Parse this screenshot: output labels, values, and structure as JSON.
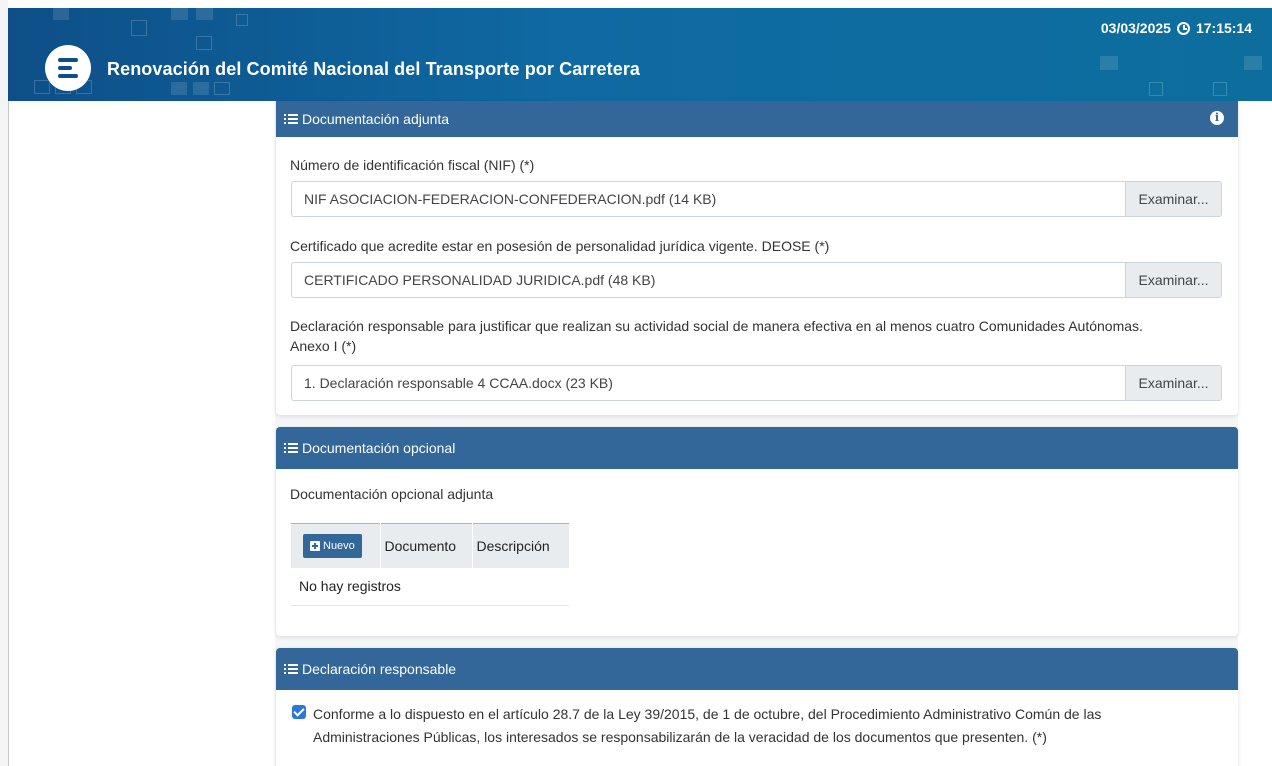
{
  "header": {
    "title": "Renovación del Comité Nacional del Transporte por Carretera",
    "date": "03/03/2025",
    "time": "17:15:14",
    "logo_icon": "app-logo",
    "clock_icon": "clock-icon",
    "gradient_start": "#0e4f88",
    "gradient_end": "#0d6e9e"
  },
  "colors": {
    "card_header": "#336699",
    "checkbox": "#2d78d2"
  },
  "attached": {
    "title": "Documentación adjunta",
    "fields": [
      {
        "label": "Número de identificación fiscal (NIF) (*)",
        "value": "NIF ASOCIACION-FEDERACION-CONFEDERACION.pdf (14 KB)",
        "button": "Examinar..."
      },
      {
        "label": "Certificado que acredite estar en posesión de personalidad jurídica vigente. DEOSE (*)",
        "value": "CERTIFICADO PERSONALIDAD JURIDICA.pdf (48 KB)",
        "button": "Examinar..."
      },
      {
        "label": "Declaración responsable para justificar que realizan su actividad social de manera efectiva en al menos cuatro Comunidades Autónomas.",
        "label2": "Anexo I (*)",
        "value": "1. Declaración responsable 4 CCAA.docx (23 KB)",
        "button": "Examinar..."
      }
    ]
  },
  "optional": {
    "title": "Documentación opcional",
    "subtitle": "Documentación opcional adjunta",
    "new_button": "Nuevo",
    "columns": [
      "Documento",
      "Descripción"
    ],
    "empty": "No hay registros"
  },
  "declaration": {
    "title": "Declaración responsable",
    "checked": true,
    "text": "Conforme a lo dispuesto en el artículo 28.7 de la Ley 39/2015, de 1 de octubre, del Procedimiento Administrativo Común de las Administraciones Públicas, los interesados se responsabilizarán de la veracidad de los documentos que presenten. (*)"
  }
}
